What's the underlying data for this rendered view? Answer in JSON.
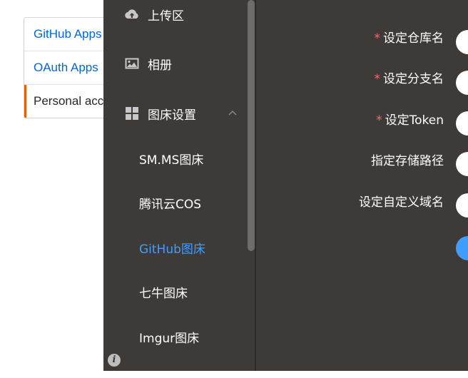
{
  "github_nav": {
    "items": [
      {
        "label": "GitHub Apps"
      },
      {
        "label": "OAuth Apps"
      },
      {
        "label": "Personal acc"
      }
    ]
  },
  "sidebar": {
    "menu": [
      {
        "label": "上传区",
        "icon": "cloud-upload-icon"
      },
      {
        "label": "相册",
        "icon": "image-icon"
      },
      {
        "label": "图床设置",
        "icon": "grid-icon"
      }
    ],
    "sub_items": [
      {
        "label": "SM.MS图床"
      },
      {
        "label": "腾讯云COS"
      },
      {
        "label": "GitHub图床"
      },
      {
        "label": "七牛图床"
      },
      {
        "label": "Imgur图床"
      }
    ]
  },
  "form": {
    "repo_label": "设定仓库名",
    "branch_label": "设定分支名",
    "token_label": "设定Token",
    "path_label": "指定存储路径",
    "domain_label": "设定自定义域名",
    "required_mark": "*"
  },
  "colors": {
    "app_bg": "#3d3a37",
    "accent": "#409eff",
    "required": "#f56c6c",
    "link": "#0366d6"
  }
}
